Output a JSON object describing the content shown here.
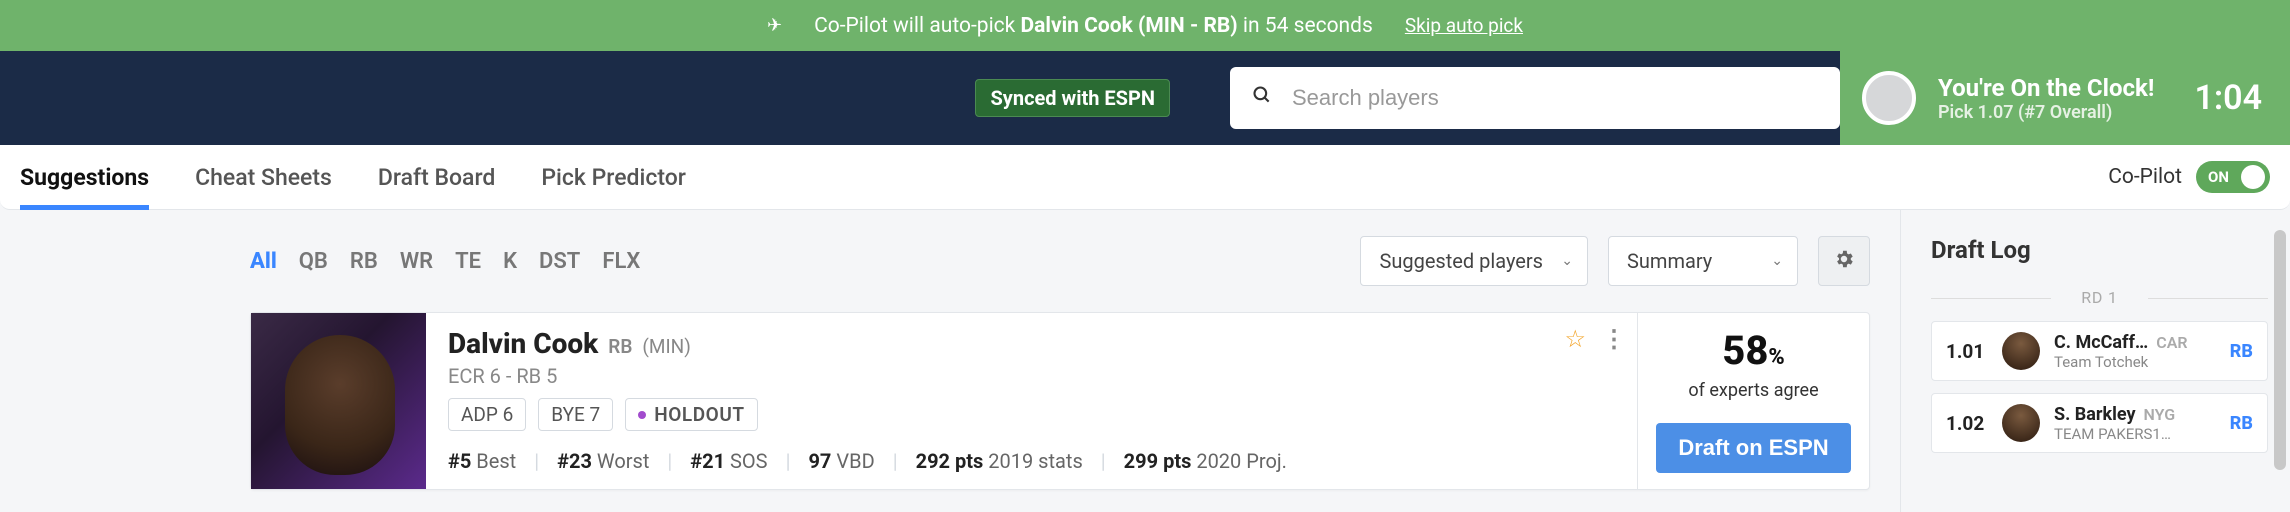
{
  "copilot_banner": {
    "prefix": "Co-Pilot will auto-pick ",
    "player": "Dalvin Cook (MIN - RB)",
    "suffix": " in 54 seconds",
    "skip": "Skip auto pick"
  },
  "navbar": {
    "sync_label": "Synced with ESPN",
    "search_placeholder": "Search players"
  },
  "clock": {
    "line1": "You're On the Clock!",
    "line2": "Pick 1.07 (#7 Overall)",
    "timer": "1:04"
  },
  "tabs": {
    "suggestions": "Suggestions",
    "cheat_sheets": "Cheat Sheets",
    "draft_board": "Draft Board",
    "pick_predictor": "Pick Predictor"
  },
  "copilot_toggle": {
    "label": "Co-Pilot",
    "state": "ON"
  },
  "pos_filters": [
    "All",
    "QB",
    "RB",
    "WR",
    "TE",
    "K",
    "DST",
    "FLX"
  ],
  "dropdowns": {
    "suggested": "Suggested players",
    "summary": "Summary"
  },
  "player": {
    "name": "Dalvin Cook",
    "pos": "RB",
    "team": "(MIN)",
    "ecr": "ECR 6 - RB 5",
    "tags": {
      "adp": "ADP 6",
      "bye": "BYE 7",
      "holdout": "HOLDOUT"
    },
    "stats": {
      "best_val": "#5",
      "best_lbl": "Best",
      "worst_val": "#23",
      "worst_lbl": "Worst",
      "sos_val": "#21",
      "sos_lbl": "SOS",
      "vbd_val": "97",
      "vbd_lbl": "VBD",
      "p2019_val": "292 pts",
      "p2019_lbl": "2019 stats",
      "p2020_val": "299 pts",
      "p2020_lbl": "2020 Proj."
    }
  },
  "expert": {
    "pct": "58",
    "pct_sym": "%",
    "label": "of experts agree",
    "button": "Draft on ESPN"
  },
  "draft_log": {
    "title": "Draft Log",
    "round_label": "RD 1",
    "items": [
      {
        "pick": "1.01",
        "name": "C. McCaff…",
        "team": "CAR",
        "owner": "Team Totchek",
        "pos": "RB"
      },
      {
        "pick": "1.02",
        "name": "S. Barkley",
        "team": "NYG",
        "owner": "TEAM PAKERS1…",
        "pos": "RB"
      }
    ]
  }
}
